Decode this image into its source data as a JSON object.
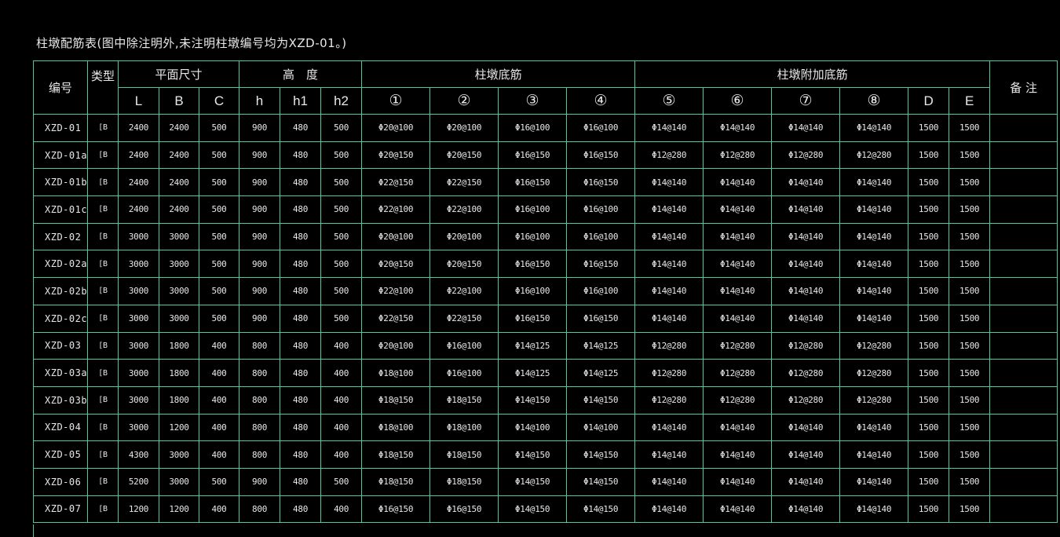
{
  "title": "柱墩配筋表(图中除注明外,未注明柱墩编号均为XZD-01。)",
  "headers": {
    "id": "编号",
    "type": "类型",
    "plan": "平面尺寸",
    "height": "高　度",
    "bottom": "柱墩底筋",
    "extra": "柱墩附加底筋",
    "remark": "备 注",
    "L": "L",
    "B": "B",
    "C": "C",
    "h": "h",
    "h1": "h1",
    "h2": "h2",
    "c1": "①",
    "c2": "②",
    "c3": "③",
    "c4": "④",
    "c5": "⑤",
    "c6": "⑥",
    "c7": "⑦",
    "c8": "⑧",
    "D": "D",
    "E": "E"
  },
  "rows": [
    [
      "XZD-01",
      "[B",
      "2400",
      "2400",
      "500",
      "900",
      "480",
      "500",
      "Φ20@100",
      "Φ20@100",
      "Φ16@100",
      "Φ16@100",
      "Φ14@140",
      "Φ14@140",
      "Φ14@140",
      "Φ14@140",
      "1500",
      "1500"
    ],
    [
      "XZD-01a",
      "[B",
      "2400",
      "2400",
      "500",
      "900",
      "480",
      "500",
      "Φ20@150",
      "Φ20@150",
      "Φ16@150",
      "Φ16@150",
      "Φ12@280",
      "Φ12@280",
      "Φ12@280",
      "Φ12@280",
      "1500",
      "1500"
    ],
    [
      "XZD-01b",
      "[B",
      "2400",
      "2400",
      "500",
      "900",
      "480",
      "500",
      "Φ22@150",
      "Φ22@150",
      "Φ16@150",
      "Φ16@150",
      "Φ14@140",
      "Φ14@140",
      "Φ14@140",
      "Φ14@140",
      "1500",
      "1500"
    ],
    [
      "XZD-01c",
      "[B",
      "2400",
      "2400",
      "500",
      "900",
      "480",
      "500",
      "Φ22@100",
      "Φ22@100",
      "Φ16@100",
      "Φ16@100",
      "Φ14@140",
      "Φ14@140",
      "Φ14@140",
      "Φ14@140",
      "1500",
      "1500"
    ],
    [
      "XZD-02",
      "[B",
      "3000",
      "3000",
      "500",
      "900",
      "480",
      "500",
      "Φ20@100",
      "Φ20@100",
      "Φ16@100",
      "Φ16@100",
      "Φ14@140",
      "Φ14@140",
      "Φ14@140",
      "Φ14@140",
      "1500",
      "1500"
    ],
    [
      "XZD-02a",
      "[B",
      "3000",
      "3000",
      "500",
      "900",
      "480",
      "500",
      "Φ20@150",
      "Φ20@150",
      "Φ16@150",
      "Φ16@150",
      "Φ14@140",
      "Φ14@140",
      "Φ14@140",
      "Φ14@140",
      "1500",
      "1500"
    ],
    [
      "XZD-02b",
      "[B",
      "3000",
      "3000",
      "500",
      "900",
      "480",
      "500",
      "Φ22@100",
      "Φ22@100",
      "Φ16@100",
      "Φ16@100",
      "Φ14@140",
      "Φ14@140",
      "Φ14@140",
      "Φ14@140",
      "1500",
      "1500"
    ],
    [
      "XZD-02c",
      "[B",
      "3000",
      "3000",
      "500",
      "900",
      "480",
      "500",
      "Φ22@150",
      "Φ22@150",
      "Φ16@150",
      "Φ16@150",
      "Φ14@140",
      "Φ14@140",
      "Φ14@140",
      "Φ14@140",
      "1500",
      "1500"
    ],
    [
      "XZD-03",
      "[B",
      "3000",
      "1800",
      "400",
      "800",
      "480",
      "400",
      "Φ20@100",
      "Φ16@100",
      "Φ14@125",
      "Φ14@125",
      "Φ12@280",
      "Φ12@280",
      "Φ12@280",
      "Φ12@280",
      "1500",
      "1500"
    ],
    [
      "XZD-03a",
      "[B",
      "3000",
      "1800",
      "400",
      "800",
      "480",
      "400",
      "Φ18@100",
      "Φ16@100",
      "Φ14@125",
      "Φ14@125",
      "Φ12@280",
      "Φ12@280",
      "Φ12@280",
      "Φ12@280",
      "1500",
      "1500"
    ],
    [
      "XZD-03b",
      "[B",
      "3000",
      "1800",
      "400",
      "800",
      "480",
      "400",
      "Φ18@150",
      "Φ18@150",
      "Φ14@150",
      "Φ14@150",
      "Φ12@280",
      "Φ12@280",
      "Φ12@280",
      "Φ12@280",
      "1500",
      "1500"
    ],
    [
      "XZD-04",
      "[B",
      "3000",
      "1200",
      "400",
      "800",
      "480",
      "400",
      "Φ18@100",
      "Φ18@100",
      "Φ14@100",
      "Φ14@100",
      "Φ14@140",
      "Φ14@140",
      "Φ14@140",
      "Φ14@140",
      "1500",
      "1500"
    ],
    [
      "XZD-05",
      "[B",
      "4300",
      "3000",
      "400",
      "800",
      "480",
      "400",
      "Φ18@150",
      "Φ18@150",
      "Φ14@150",
      "Φ14@150",
      "Φ14@140",
      "Φ14@140",
      "Φ14@140",
      "Φ14@140",
      "1500",
      "1500"
    ],
    [
      "XZD-06",
      "[B",
      "5200",
      "3000",
      "500",
      "900",
      "480",
      "500",
      "Φ18@150",
      "Φ18@150",
      "Φ14@150",
      "Φ14@150",
      "Φ14@140",
      "Φ14@140",
      "Φ14@140",
      "Φ14@140",
      "1500",
      "1500"
    ],
    [
      "XZD-07",
      "[B",
      "1200",
      "1200",
      "400",
      "800",
      "480",
      "400",
      "Φ16@150",
      "Φ16@150",
      "Φ14@150",
      "Φ14@150",
      "Φ14@140",
      "Φ14@140",
      "Φ14@140",
      "Φ14@140",
      "1500",
      "1500"
    ]
  ],
  "colors": {
    "grid": "#4ec9a4",
    "text": "#e8e8e8",
    "background": "#000000"
  }
}
